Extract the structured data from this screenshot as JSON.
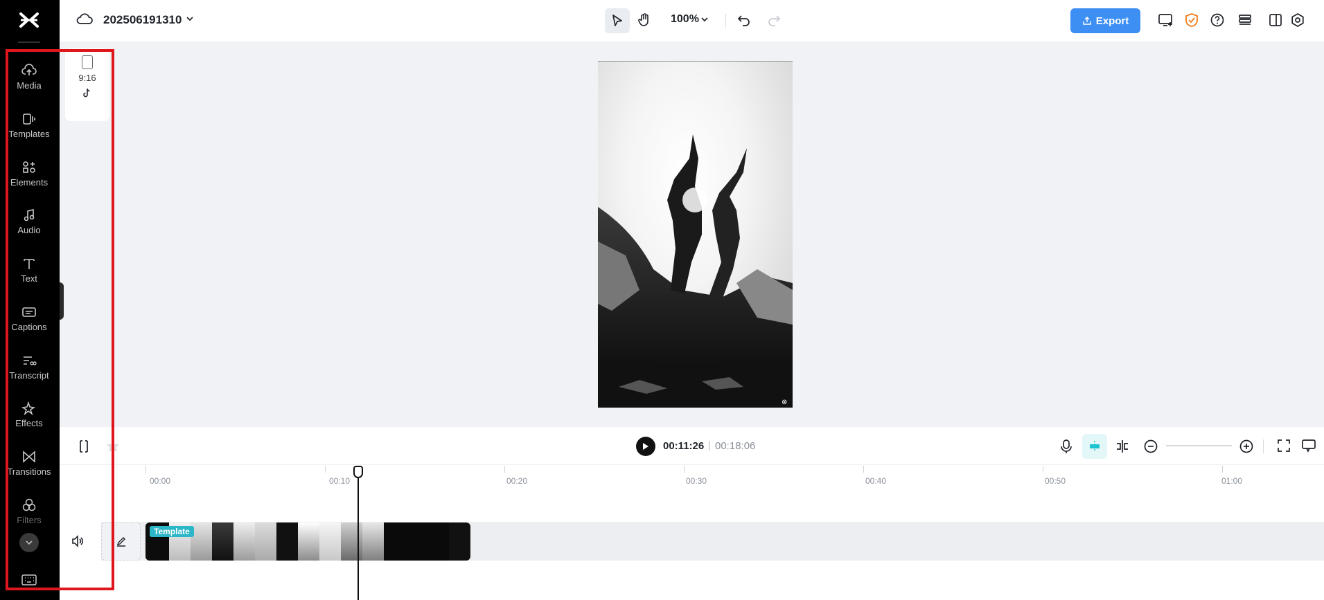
{
  "sidebar": {
    "items": [
      {
        "label": "Media",
        "icon": "cloud-upload-icon"
      },
      {
        "label": "Templates",
        "icon": "templates-icon"
      },
      {
        "label": "Elements",
        "icon": "elements-icon"
      },
      {
        "label": "Audio",
        "icon": "music-note-icon"
      },
      {
        "label": "Text",
        "icon": "text-icon"
      },
      {
        "label": "Captions",
        "icon": "captions-icon"
      },
      {
        "label": "Transcript",
        "icon": "transcript-icon"
      },
      {
        "label": "Effects",
        "icon": "effects-icon"
      },
      {
        "label": "Transitions",
        "icon": "transitions-icon"
      },
      {
        "label": "Filters",
        "icon": "filters-icon"
      }
    ]
  },
  "header": {
    "project_name": "202506191310",
    "zoom": "100%",
    "export_label": "Export"
  },
  "canvas": {
    "ratio_label": "9:16"
  },
  "timeline": {
    "current_time": "00:11:26",
    "separator": "|",
    "total_time": "00:18:06",
    "ticks": [
      "00:00",
      "00:10",
      "00:20",
      "00:30",
      "00:40",
      "00:50",
      "01:00"
    ],
    "clip_tag": "Template"
  },
  "colors": {
    "accent": "#3d8ff4",
    "sidebar_bg": "#000000",
    "highlight": "#e0161d",
    "tag": "#2bb7c7"
  }
}
